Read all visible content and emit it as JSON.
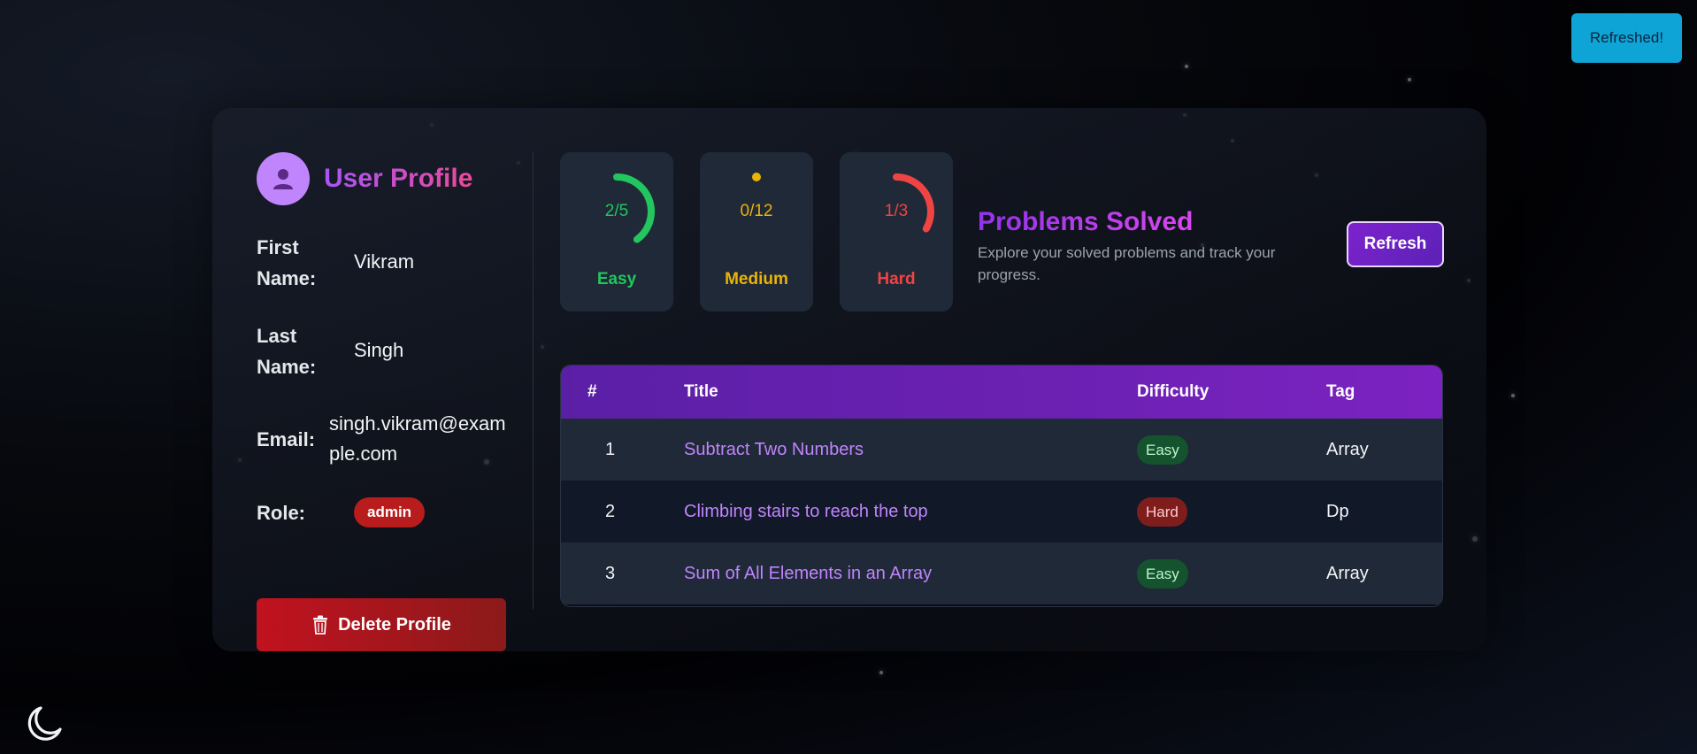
{
  "toast": {
    "text": "Refreshed!"
  },
  "profile": {
    "title": "User Profile",
    "fields": {
      "first_name": {
        "label": "First Name:",
        "value": "Vikram"
      },
      "last_name": {
        "label": "Last Name:",
        "value": "Singh"
      },
      "email": {
        "label": "Email:",
        "value": "singh.vikram@example.com"
      },
      "role": {
        "label": "Role:",
        "value": "admin"
      }
    },
    "delete_label": "Delete Profile",
    "delete_icon": "trash-icon"
  },
  "stats": [
    {
      "name": "Easy",
      "solved": "2/5",
      "fraction": 0.4,
      "color": "#22c55e"
    },
    {
      "name": "Medium",
      "solved": "0/12",
      "fraction": 0,
      "color": "#eab308"
    },
    {
      "name": "Hard",
      "solved": "1/3",
      "fraction": 0.3333,
      "color": "#ef4444"
    }
  ],
  "problems_solved": {
    "title": "Problems Solved",
    "description": "Explore your solved problems and track your progress.",
    "refresh_label": "Refresh"
  },
  "table": {
    "headers": {
      "num": "#",
      "title": "Title",
      "difficulty": "Difficulty",
      "tag": "Tag"
    },
    "rows": [
      {
        "num": "1",
        "title": "Subtract Two Numbers",
        "difficulty": "Easy",
        "tag": "Array"
      },
      {
        "num": "2",
        "title": "Climbing stairs to reach the top",
        "difficulty": "Hard",
        "tag": "Dp"
      },
      {
        "num": "3",
        "title": "Sum of All Elements in an Array",
        "difficulty": "Easy",
        "tag": "Array"
      }
    ]
  },
  "theme_toggle_icon": "moon-icon"
}
